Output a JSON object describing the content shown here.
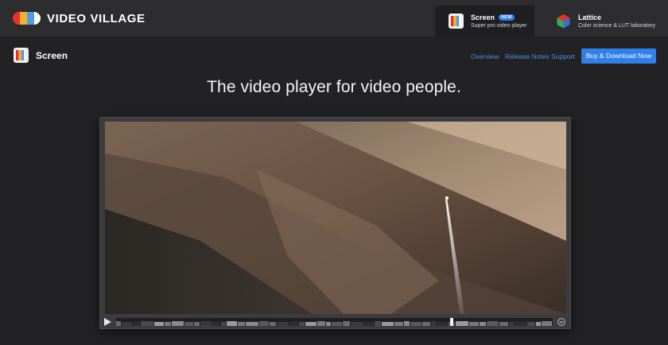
{
  "brand": {
    "name": "VIDEO VILLAGE",
    "logo_colors": [
      "#e8312a",
      "#f3b22a",
      "#4f9de5",
      "#ffffff"
    ]
  },
  "product_tabs": [
    {
      "title": "Screen",
      "badge": "NEW",
      "subtitle": "Super pro video player",
      "icon": "screen-app-icon",
      "active": true
    },
    {
      "title": "Lattice",
      "subtitle": "Color science & LUT laboratory",
      "icon": "lattice-cube-icon",
      "active": false
    }
  ],
  "subnav": {
    "title": "Screen",
    "links": [
      "Overview",
      "Release Notes",
      "Support"
    ],
    "cta": "Buy & Download Now"
  },
  "headline": "The video player for video people.",
  "player": {
    "playhead_fraction": 0.765,
    "controls": [
      "play-icon",
      "options-chevron-icon"
    ]
  },
  "colors": {
    "accent": "#2f80e8",
    "link": "#4a8fe6",
    "page_bg": "#222224",
    "topbar_bg": "#2d2d30"
  }
}
